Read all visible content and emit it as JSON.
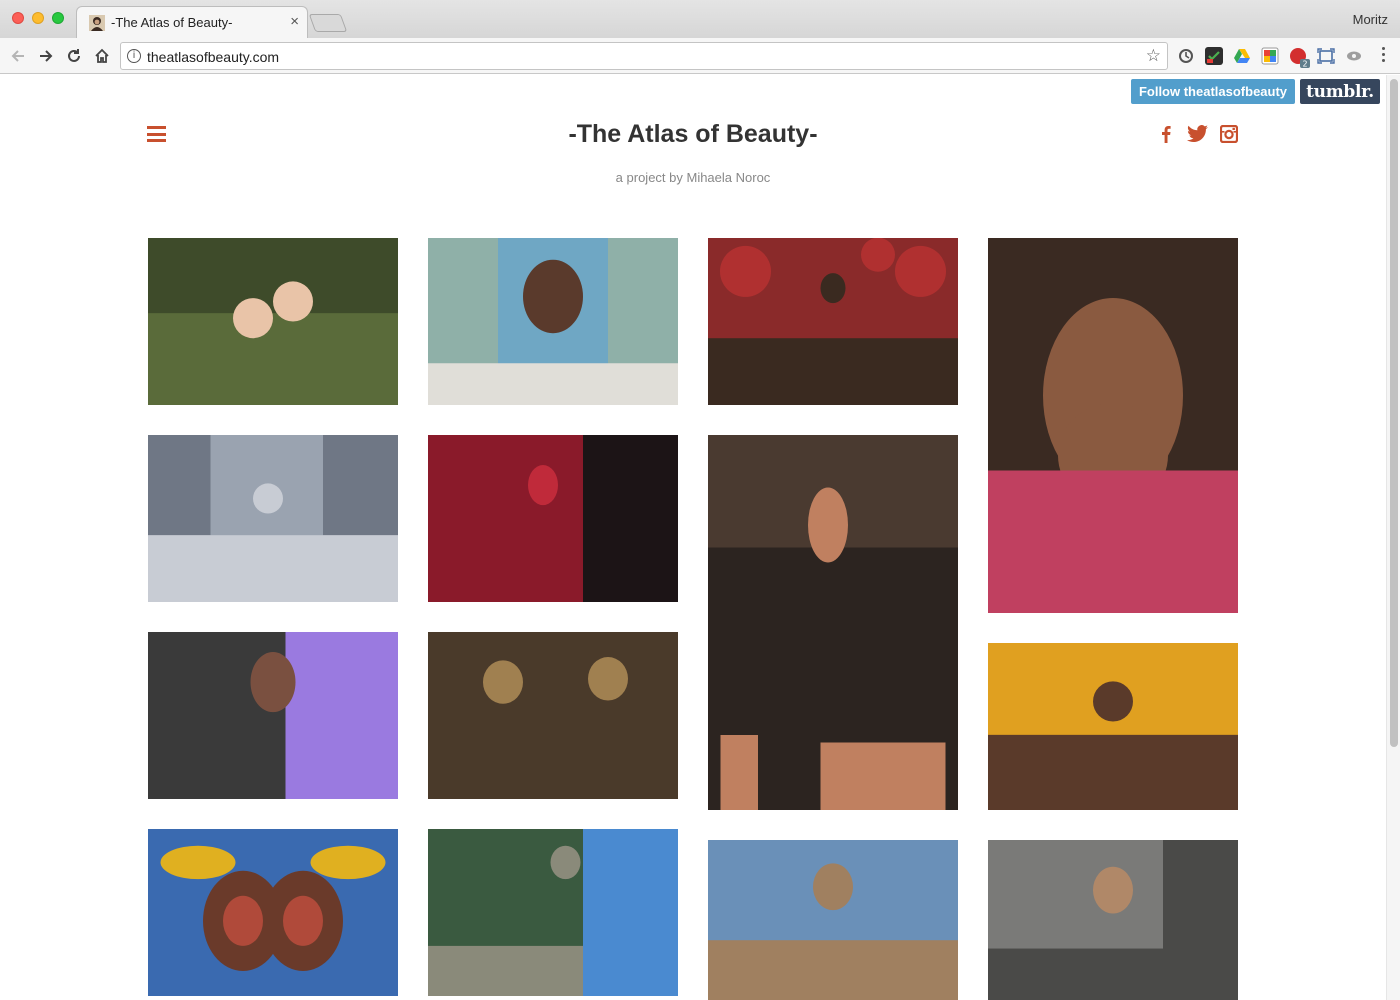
{
  "browser": {
    "tab_title": "-The Atlas of Beauty-",
    "url": "theatlasofbeauty.com",
    "profile_name": "Moritz",
    "tab_close_glyph": "×",
    "bookmark_glyph": "☆"
  },
  "page": {
    "follow_label": "Follow theatlasofbeauty",
    "tumblr_label": "tumblr.",
    "title": "-The Atlas of Beauty-",
    "subtitle": "a project by Mihaela Noroc",
    "accent_color": "#c8502e",
    "social_icons": [
      "facebook-icon",
      "twitter-icon",
      "instagram-icon"
    ]
  },
  "gallery": [
    {
      "id": "two-women-park",
      "palette": [
        "#5a6b3a",
        "#3e4b2a",
        "#a83a2a",
        "#e9c4a8"
      ]
    },
    {
      "id": "woman-colorful-street",
      "palette": [
        "#6fa7c4",
        "#8fb0a8",
        "#e0ded8",
        "#5a3a2c"
      ]
    },
    {
      "id": "woman-yellow-headscarf",
      "palette": [
        "#8a2a2a",
        "#b03030",
        "#e6c020",
        "#3a2a20"
      ]
    },
    {
      "id": "elderly-woman-hands-face",
      "palette": [
        "#3a2a22",
        "#8a5a40",
        "#c04060",
        "#1a1412"
      ]
    },
    {
      "id": "woman-times-square",
      "palette": [
        "#9aa3b0",
        "#6f7785",
        "#2a2a2e",
        "#c8ccd4"
      ]
    },
    {
      "id": "woman-white-hijab",
      "palette": [
        "#8a1a2a",
        "#c02a3a",
        "#f0d8d0",
        "#1c1416"
      ]
    },
    {
      "id": "woman-purple-apron",
      "palette": [
        "#2c2420",
        "#4a3a30",
        "#5a3ab0",
        "#c08060"
      ]
    },
    {
      "id": "girl-embroidered-blouse",
      "palette": [
        "#e0a020",
        "#c8c0a8",
        "#2a5aa8",
        "#5a3a2a"
      ]
    },
    {
      "id": "mother-daughter-child",
      "palette": [
        "#3a3a3a",
        "#9a7ae0",
        "#e8d030",
        "#7a5040"
      ]
    },
    {
      "id": "elderly-woman-black-veil",
      "palette": [
        "#4a3a2a",
        "#7a6040",
        "#1a1614",
        "#a08050"
      ]
    },
    {
      "id": "twins-mural",
      "palette": [
        "#3a6ab0",
        "#e0b020",
        "#6a3a2a",
        "#b04a3a"
      ]
    },
    {
      "id": "woman-graffiti-stripes",
      "palette": [
        "#3a5a40",
        "#4a8ad0",
        "#1a1a1a",
        "#8a8a7a"
      ]
    },
    {
      "id": "woman-white-cardigan",
      "palette": [
        "#6a90b8",
        "#3a2a24",
        "#d8c8b0",
        "#a08060"
      ]
    },
    {
      "id": "woman-street-blur",
      "palette": [
        "#7a7a78",
        "#4a4a48",
        "#1a1614",
        "#b08868"
      ]
    }
  ]
}
